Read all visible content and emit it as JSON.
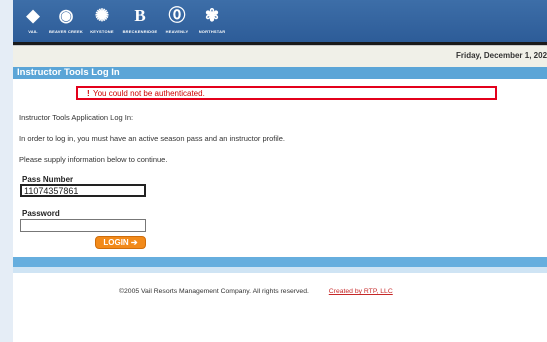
{
  "header": {
    "resorts": [
      {
        "name": "VAIL",
        "icon": "vail-logo-icon"
      },
      {
        "name": "BEAVER CREEK",
        "icon": "beaver-creek-logo-icon"
      },
      {
        "name": "KEYSTONE",
        "icon": "keystone-logo-icon"
      },
      {
        "name": "BRECKENRIDGE",
        "icon": "breckenridge-logo-icon"
      },
      {
        "name": "HEAVENLY",
        "icon": "heavenly-logo-icon"
      },
      {
        "name": "NORTHSTAR",
        "icon": "northstar-logo-icon"
      }
    ],
    "date": "Friday, December 1, 202"
  },
  "title": "Instructor Tools Log In",
  "error": {
    "mark": "!",
    "message": "You could not be authenticated."
  },
  "content": {
    "heading": "Instructor Tools Application Log In:",
    "instructions": "In order to log in, you must have an active season pass and an instructor profile.",
    "prompt": "Please supply information below to continue."
  },
  "form": {
    "pass_label": "Pass Number",
    "pass_value": "11074357861",
    "password_label": "Password",
    "password_value": "",
    "login_label": "LOGIN ➔"
  },
  "footer": {
    "copyright": "©2005 Vail Resorts Management Company. All rights reserved.",
    "credit": "Created by RTP, LLC"
  },
  "colors": {
    "banner": "#2d5c98",
    "title_bar": "#5ba5d7",
    "error_border": "#e3001b",
    "login_button": "#f28a1a",
    "credit_link": "#c62828"
  }
}
